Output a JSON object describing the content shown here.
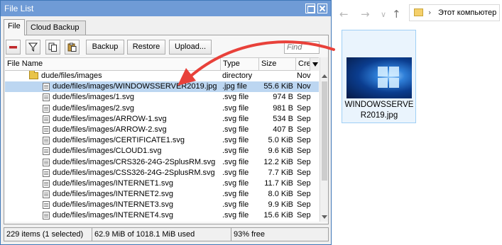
{
  "window": {
    "title": "File List",
    "tabs": [
      {
        "label": "File",
        "active": true
      },
      {
        "label": "Cloud Backup",
        "active": false
      }
    ]
  },
  "toolbar": {
    "icons": [
      "remove-icon",
      "filter-icon",
      "copy-icon",
      "paste-icon"
    ],
    "backup_label": "Backup",
    "restore_label": "Restore",
    "upload_label": "Upload...",
    "find_placeholder": "Find"
  },
  "table": {
    "columns": [
      "File Name",
      "Type",
      "Size",
      "Creati"
    ],
    "rows": [
      {
        "name": "dude/files/images",
        "type": "directory",
        "size": "",
        "created": "Nov",
        "kind": "folder",
        "indent": 1,
        "selected": false
      },
      {
        "name": "dude/files/images/WINDOWSSERVER2019.jpg",
        "type": ".jpg file",
        "size": "55.6 KiB",
        "created": "Nov",
        "kind": "file",
        "indent": 2,
        "selected": true
      },
      {
        "name": "dude/files/images/1.svg",
        "type": ".svg file",
        "size": "974 B",
        "created": "Sep",
        "kind": "file",
        "indent": 2,
        "selected": false
      },
      {
        "name": "dude/files/images/2.svg",
        "type": ".svg file",
        "size": "981 B",
        "created": "Sep",
        "kind": "file",
        "indent": 2,
        "selected": false
      },
      {
        "name": "dude/files/images/ARROW-1.svg",
        "type": ".svg file",
        "size": "534 B",
        "created": "Sep",
        "kind": "file",
        "indent": 2,
        "selected": false
      },
      {
        "name": "dude/files/images/ARROW-2.svg",
        "type": ".svg file",
        "size": "407 B",
        "created": "Sep",
        "kind": "file",
        "indent": 2,
        "selected": false
      },
      {
        "name": "dude/files/images/CERTIFICATE1.svg",
        "type": ".svg file",
        "size": "5.0 KiB",
        "created": "Sep",
        "kind": "file",
        "indent": 2,
        "selected": false
      },
      {
        "name": "dude/files/images/CLOUD1.svg",
        "type": ".svg file",
        "size": "9.6 KiB",
        "created": "Sep",
        "kind": "file",
        "indent": 2,
        "selected": false
      },
      {
        "name": "dude/files/images/CRS326-24G-2SplusRM.svg",
        "type": ".svg file",
        "size": "12.2 KiB",
        "created": "Sep",
        "kind": "file",
        "indent": 2,
        "selected": false
      },
      {
        "name": "dude/files/images/CSS326-24G-2SplusRM.svg",
        "type": ".svg file",
        "size": "7.7 KiB",
        "created": "Sep",
        "kind": "file",
        "indent": 2,
        "selected": false
      },
      {
        "name": "dude/files/images/INTERNET1.svg",
        "type": ".svg file",
        "size": "11.7 KiB",
        "created": "Sep",
        "kind": "file",
        "indent": 2,
        "selected": false
      },
      {
        "name": "dude/files/images/INTERNET2.svg",
        "type": ".svg file",
        "size": "8.0 KiB",
        "created": "Sep",
        "kind": "file",
        "indent": 2,
        "selected": false
      },
      {
        "name": "dude/files/images/INTERNET3.svg",
        "type": ".svg file",
        "size": "9.9 KiB",
        "created": "Sep",
        "kind": "file",
        "indent": 2,
        "selected": false
      },
      {
        "name": "dude/files/images/INTERNET4.svg",
        "type": ".svg file",
        "size": "15.6 KiB",
        "created": "Sep",
        "kind": "file",
        "indent": 2,
        "selected": false
      }
    ]
  },
  "status": {
    "items": "229 items (1 selected)",
    "usage": "62.9 MiB of 1018.1 MiB used",
    "free": "93% free"
  },
  "explorer": {
    "breadcrumb": "Этот компьютер",
    "file_name": "WINDOWSSERVER2019.jpg",
    "accent": "#e8413a"
  }
}
